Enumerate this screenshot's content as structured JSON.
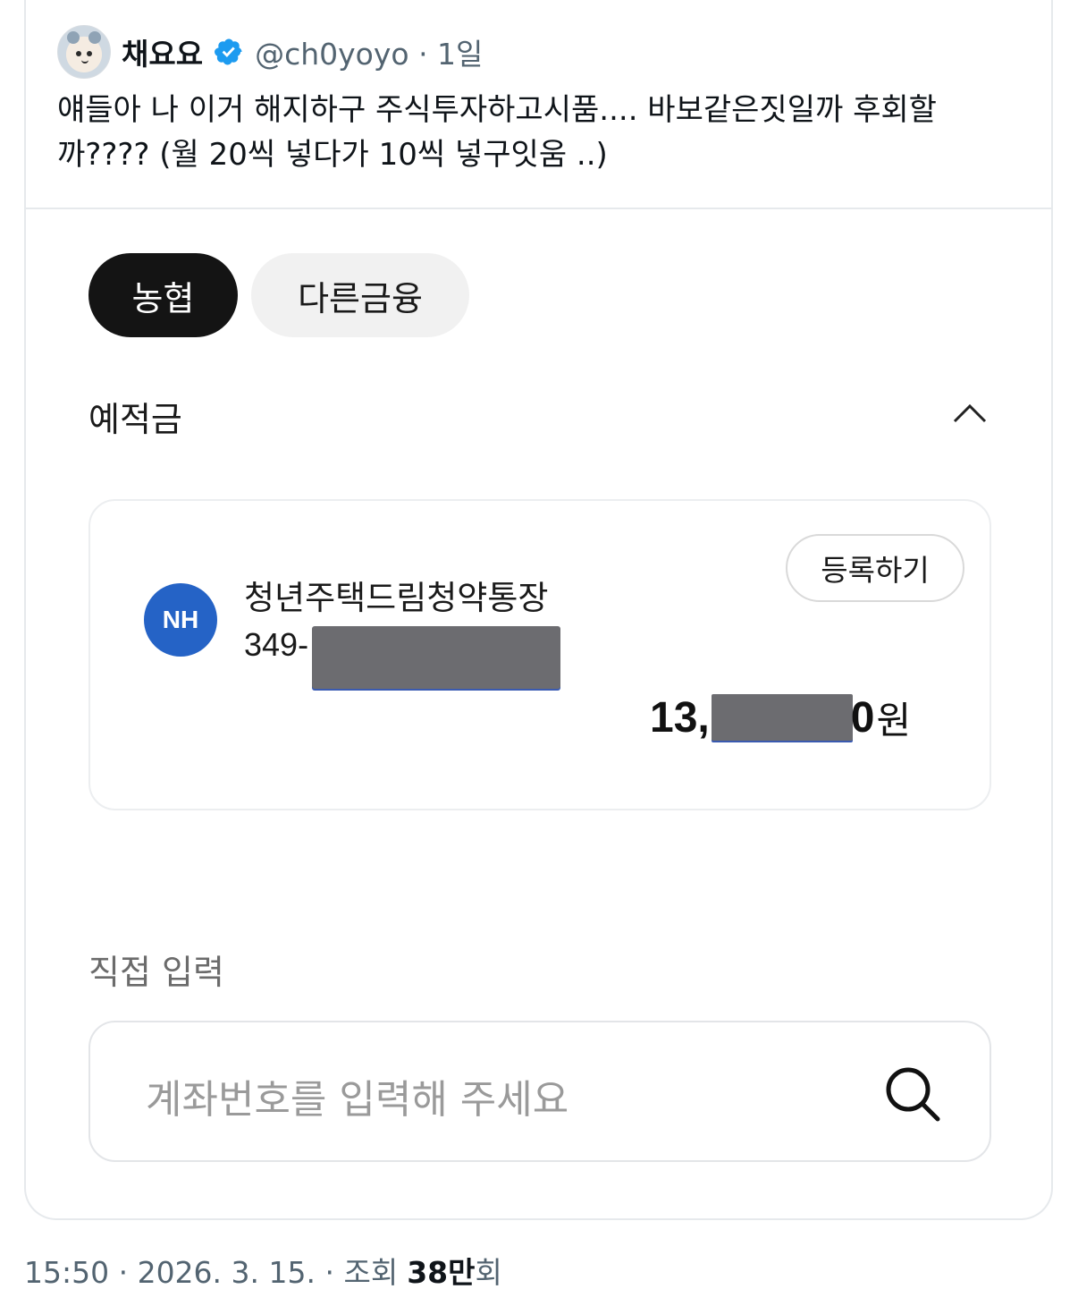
{
  "tweet": {
    "author": {
      "display_name": "채요요",
      "handle_line": "@ch0yoyo · 1일",
      "verified_color": "#1d9bf0"
    },
    "text": "얘들아 나 이거 해지하구 주식투자하고시품.... 바보같은짓일까 후회할까???? (월 20씩 넣다가 10씩 넣구잇움 ..)"
  },
  "embedded_screenshot": {
    "tabs": [
      {
        "label": "농협",
        "active": true
      },
      {
        "label": "다른금융",
        "active": false
      }
    ],
    "section_title": "예적금",
    "account": {
      "bank_logo_text": "NH",
      "bank_color": "#2563c6",
      "name": "청년주택드림청약통장",
      "number_prefix": "349-",
      "register_label": "등록하기",
      "balance_prefix": "13,",
      "balance_suffix": "0",
      "balance_unit": "원"
    },
    "direct_input": {
      "label": "직접 입력",
      "placeholder": "계좌번호를 입력해 주세요"
    }
  },
  "meta": {
    "timestamp": "15:50 · 2026. 3. 15. · 조회",
    "views_count": "38만",
    "views_unit": "회"
  }
}
